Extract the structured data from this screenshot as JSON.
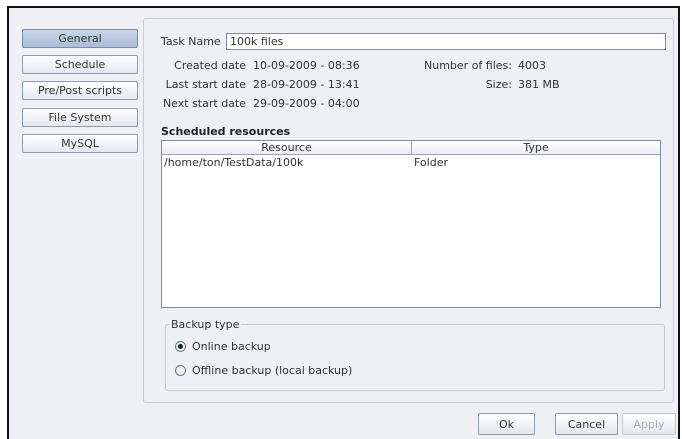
{
  "nav": {
    "items": [
      {
        "label": "General",
        "selected": true
      },
      {
        "label": "Schedule",
        "selected": false
      },
      {
        "label": "Pre/Post scripts",
        "selected": false
      },
      {
        "label": "File System",
        "selected": false
      },
      {
        "label": "MySQL",
        "selected": false
      }
    ]
  },
  "task": {
    "name_label": "Task Name",
    "name_value": "100k files",
    "created_label": "Created date",
    "created_value": "10-09-2009 - 08:36",
    "last_start_label": "Last start date",
    "last_start_value": "28-09-2009 - 13:41",
    "next_start_label": "Next start date",
    "next_start_value": "29-09-2009 - 04:00",
    "num_files_label": "Number of files:",
    "num_files_value": "4003",
    "size_label": "Size:",
    "size_value": "381 MB"
  },
  "resources": {
    "title": "Scheduled resources",
    "columns": [
      "Resource",
      "Type"
    ],
    "rows": [
      {
        "resource": "/home/ton/TestData/100k",
        "type": "Folder"
      }
    ]
  },
  "backup": {
    "title": "Backup type",
    "options": [
      {
        "label": "Online backup",
        "checked": true
      },
      {
        "label": "Offline backup (local backup)",
        "checked": false
      }
    ]
  },
  "buttons": {
    "ok": "Ok",
    "cancel": "Cancel",
    "apply": "Apply",
    "apply_enabled": false
  }
}
